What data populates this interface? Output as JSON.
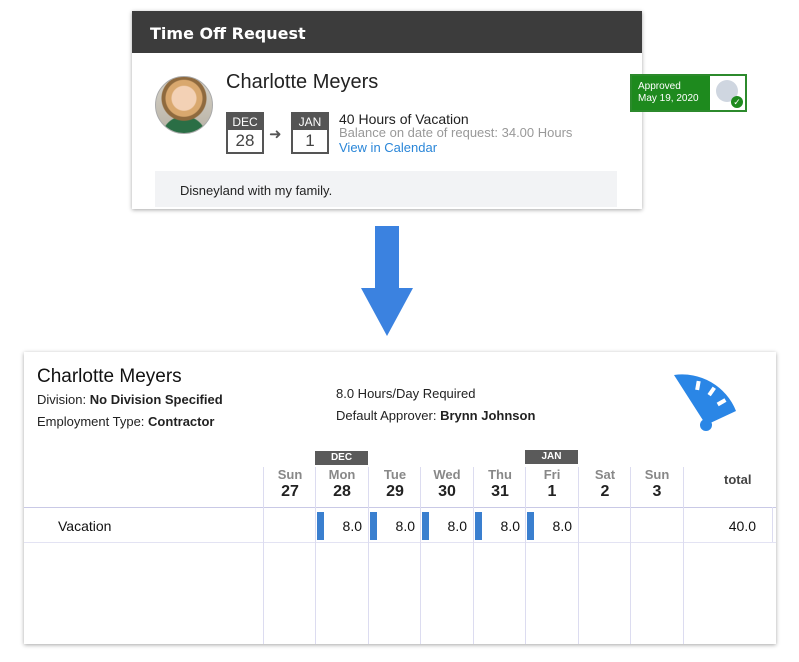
{
  "request_card": {
    "header_title": "Time Off Request",
    "employee_name": "Charlotte Meyers",
    "from": {
      "month": "DEC",
      "day": "28"
    },
    "to": {
      "month": "JAN",
      "day": "1"
    },
    "hours_summary": "40 Hours of Vacation",
    "balance_text": "Balance on date of request: 34.00 Hours",
    "calendar_link": "View in Calendar",
    "status": {
      "label": "Approved",
      "date": "May 19, 2020",
      "color": "#1e8a1e"
    },
    "note": "Disneyland with my family."
  },
  "timesheet": {
    "employee_name": "Charlotte Meyers",
    "division_label": "Division: ",
    "division_value": "No Division Specified",
    "employment_label": "Employment Type: ",
    "employment_value": "Contractor",
    "hours_required": "8.0 Hours/Day Required",
    "approver_label": "Default Approver: ",
    "approver_value": "Brynn Johnson",
    "month_tags": [
      "DEC",
      "JAN"
    ],
    "days": [
      {
        "name": "Sun",
        "date": "27"
      },
      {
        "name": "Mon",
        "date": "28"
      },
      {
        "name": "Tue",
        "date": "29"
      },
      {
        "name": "Wed",
        "date": "30"
      },
      {
        "name": "Thu",
        "date": "31"
      },
      {
        "name": "Fri",
        "date": "1"
      },
      {
        "name": "Sat",
        "date": "2"
      },
      {
        "name": "Sun",
        "date": "3"
      }
    ],
    "total_header": "total",
    "row": {
      "label": "Vacation",
      "values": [
        "",
        "8.0",
        "8.0",
        "8.0",
        "8.0",
        "8.0",
        "",
        ""
      ],
      "total": "40.0"
    },
    "accent_color": "#2a86e6"
  }
}
